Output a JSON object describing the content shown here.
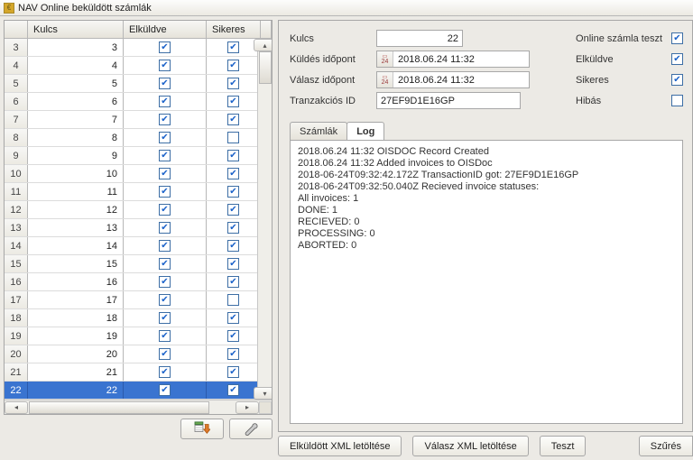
{
  "window": {
    "title": "NAV Online beküldött számlák"
  },
  "table": {
    "headers": {
      "kulcs": "Kulcs",
      "elkuldve": "Elküldve",
      "sikeres": "Sikeres"
    },
    "rows": [
      {
        "idx": "3",
        "kulcs": "3",
        "elkuldve": true,
        "sikeres": true
      },
      {
        "idx": "4",
        "kulcs": "4",
        "elkuldve": true,
        "sikeres": true
      },
      {
        "idx": "5",
        "kulcs": "5",
        "elkuldve": true,
        "sikeres": true
      },
      {
        "idx": "6",
        "kulcs": "6",
        "elkuldve": true,
        "sikeres": true
      },
      {
        "idx": "7",
        "kulcs": "7",
        "elkuldve": true,
        "sikeres": true
      },
      {
        "idx": "8",
        "kulcs": "8",
        "elkuldve": true,
        "sikeres": false
      },
      {
        "idx": "9",
        "kulcs": "9",
        "elkuldve": true,
        "sikeres": true
      },
      {
        "idx": "10",
        "kulcs": "10",
        "elkuldve": true,
        "sikeres": true
      },
      {
        "idx": "11",
        "kulcs": "11",
        "elkuldve": true,
        "sikeres": true
      },
      {
        "idx": "12",
        "kulcs": "12",
        "elkuldve": true,
        "sikeres": true
      },
      {
        "idx": "13",
        "kulcs": "13",
        "elkuldve": true,
        "sikeres": true
      },
      {
        "idx": "14",
        "kulcs": "14",
        "elkuldve": true,
        "sikeres": true
      },
      {
        "idx": "15",
        "kulcs": "15",
        "elkuldve": true,
        "sikeres": true
      },
      {
        "idx": "16",
        "kulcs": "16",
        "elkuldve": true,
        "sikeres": true
      },
      {
        "idx": "17",
        "kulcs": "17",
        "elkuldve": true,
        "sikeres": false
      },
      {
        "idx": "18",
        "kulcs": "18",
        "elkuldve": true,
        "sikeres": true
      },
      {
        "idx": "19",
        "kulcs": "19",
        "elkuldve": true,
        "sikeres": true
      },
      {
        "idx": "20",
        "kulcs": "20",
        "elkuldve": true,
        "sikeres": true
      },
      {
        "idx": "21",
        "kulcs": "21",
        "elkuldve": true,
        "sikeres": true
      },
      {
        "idx": "22",
        "kulcs": "22",
        "elkuldve": true,
        "sikeres": true,
        "selected": true
      }
    ]
  },
  "form": {
    "labels": {
      "kulcs": "Kulcs",
      "kuldes_idopont": "Küldés időpont",
      "valasz_idopont": "Válasz időpont",
      "tranzakcios_id": "Tranzakciós ID",
      "online_szamla_teszt": "Online számla teszt",
      "elkuldve": "Elküldve",
      "sikeres": "Sikeres",
      "hibas": "Hibás"
    },
    "values": {
      "kulcs": "22",
      "kuldes_idopont": "2018.06.24 11:32",
      "valasz_idopont": "2018.06.24 11:32",
      "tranzakcios_id": "27EF9D1E16GP",
      "online_szamla_teszt": true,
      "elkuldve": true,
      "sikeres": true,
      "hibas": false,
      "cal_day": "24"
    }
  },
  "tabs": {
    "szamlak": "Számlák",
    "log": "Log",
    "active": "log"
  },
  "log_text": "2018.06.24 11:32 OISDOC Record Created\n2018.06.24 11:32 Added invoices to OISDoc\n2018-06-24T09:32:42.172Z TransactionID got: 27EF9D1E16GP\n2018-06-24T09:32:50.040Z Recieved invoice statuses:\nAll invoices: 1\nDONE: 1\nRECIEVED: 0\nPROCESSING: 0\nABORTED: 0",
  "buttons": {
    "elkuldott_xml": "Elküldött XML letöltése",
    "valasz_xml": "Válasz XML letöltése",
    "teszt": "Teszt",
    "szures": "Szűrés"
  }
}
